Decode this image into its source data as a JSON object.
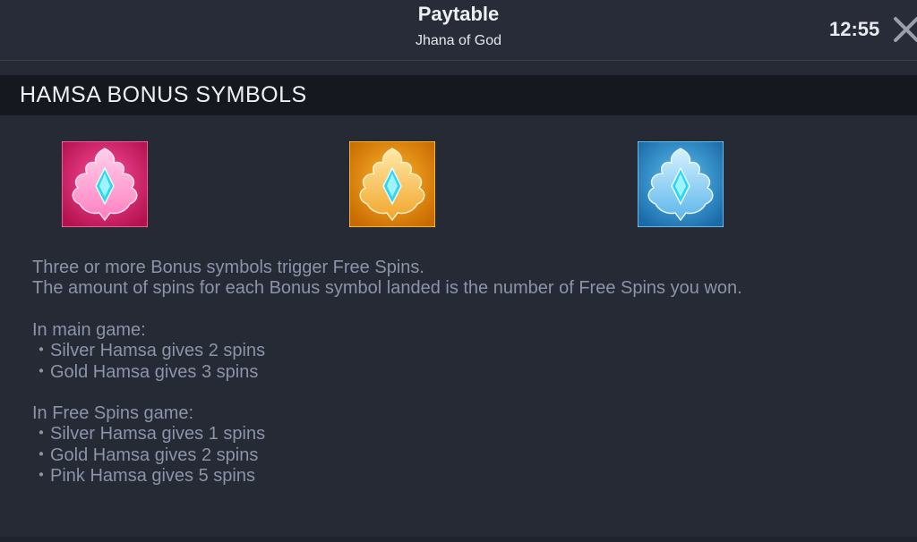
{
  "header": {
    "title": "Paytable",
    "subtitle": "Jhana of God",
    "clock": "12:55",
    "close_icon": "close-icon"
  },
  "section": {
    "title": "HAMSA BONUS SYMBOLS"
  },
  "symbols": [
    {
      "name": "pink-hamsa",
      "color": "#d81b6a",
      "icon": "hamsa-icon"
    },
    {
      "name": "gold-hamsa",
      "color": "#e89a0c",
      "icon": "hamsa-icon"
    },
    {
      "name": "silver-hamsa",
      "color": "#2a8fd0",
      "icon": "hamsa-icon"
    }
  ],
  "description": {
    "intro_1": "Three or more Bonus symbols trigger Free Spins.",
    "intro_2": "The amount of spins for each Bonus symbol landed is the number of Free Spins you won.",
    "main_heading": "In main game:",
    "main_items": [
      "・Silver Hamsa gives 2 spins",
      "・Gold Hamsa gives 3 spins"
    ],
    "free_heading": "In Free Spins game:",
    "free_items": [
      "・Silver Hamsa gives 1 spins",
      "・Gold Hamsa gives 2 spins",
      "・Pink Hamsa gives 5 spins"
    ]
  },
  "colors": {
    "background": "#252a35",
    "header_bar": "#15181e",
    "text_muted": "#8b94a8"
  }
}
